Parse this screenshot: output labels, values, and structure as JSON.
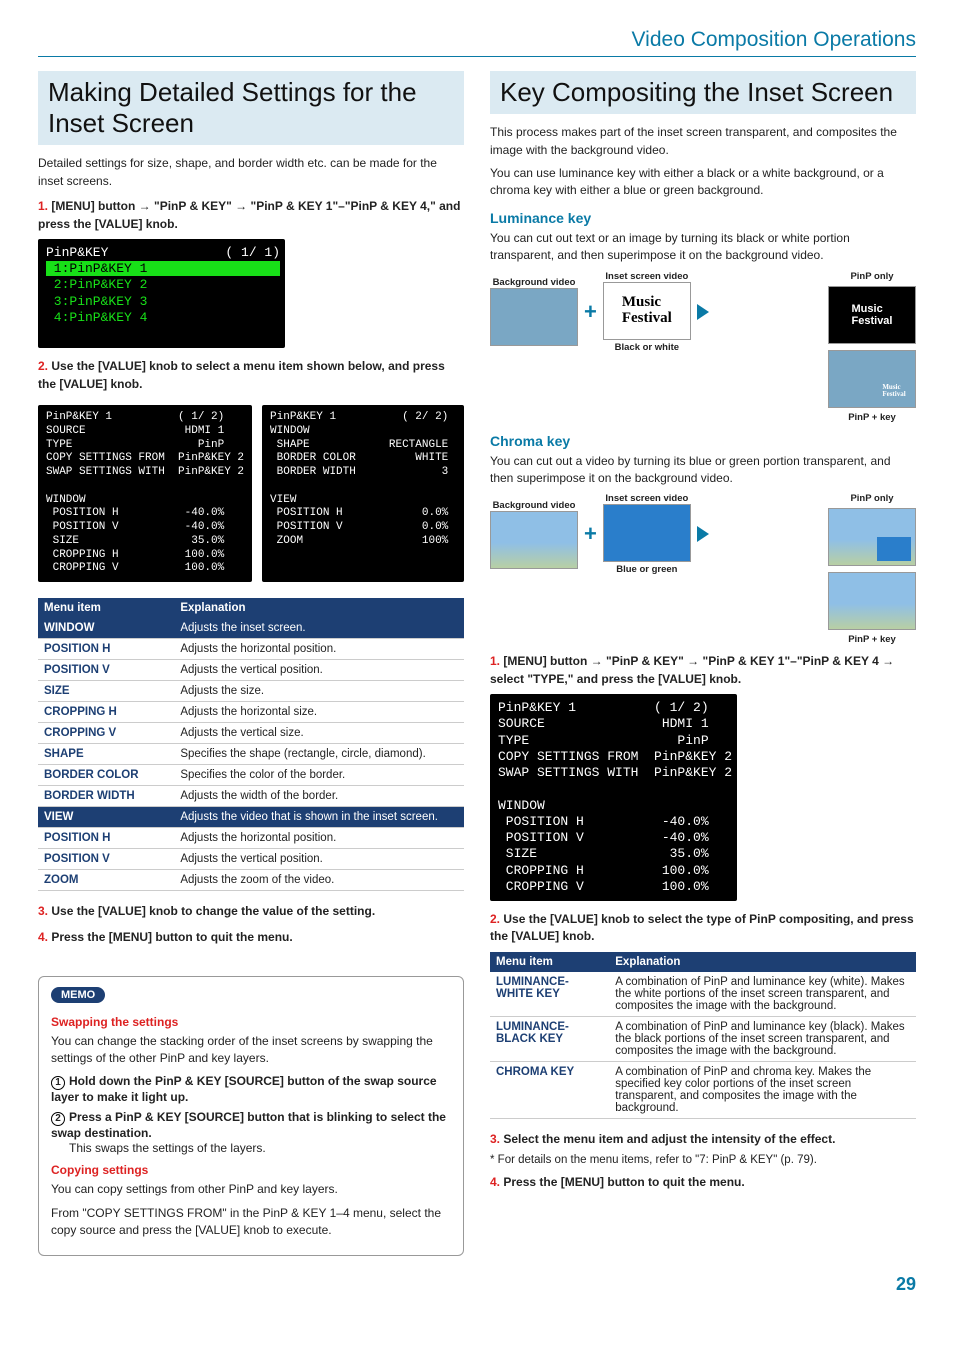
{
  "section_header": "Video Composition Operations",
  "left": {
    "title": "Making Detailed Settings for the Inset Screen",
    "intro": "Detailed settings for size, shape, and border width etc. can be made for the inset screens.",
    "step1_num": "1.",
    "step1_text": "[MENU] button → \"PinP & KEY\" → \"PinP & KEY 1\"–\"PinP & KEY 4,\" and press the [VALUE] knob.",
    "screen1": {
      "title_row": "PinP&KEY               ( 1/ 1)",
      "sel": " 1:PinP&KEY 1                 ",
      "lines": " 2:PinP&KEY 2\n 3:PinP&KEY 3\n 4:PinP&KEY 4\n\n"
    },
    "step2_num": "2.",
    "step2_text": "Use the [VALUE] knob to select a menu item shown below, and press the [VALUE] knob.",
    "screen2a": "PinP&KEY 1          ( 1/ 2)\nSOURCE               HDMI 1\nTYPE                   PinP\nCOPY SETTINGS FROM  PinP&KEY 2\nSWAP SETTINGS WITH  PinP&KEY 2\n\nWINDOW\n POSITION H          -40.0%\n POSITION V          -40.0%\n SIZE                 35.0%\n CROPPING H          100.0%\n CROPPING V          100.0%",
    "screen2b": "PinP&KEY 1          ( 2/ 2)\nWINDOW\n SHAPE            RECTANGLE\n BORDER COLOR         WHITE\n BORDER WIDTH             3\n\nVIEW\n POSITION H            0.0%\n POSITION V            0.0%\n ZOOM                  100%\n\n",
    "table_head": {
      "col1": "Menu item",
      "col2": "Explanation"
    },
    "rows": [
      {
        "k": "WINDOW",
        "v": "Adjusts the inset screen."
      },
      {
        "k": "POSITION H",
        "v": "Adjusts the horizontal position."
      },
      {
        "k": "POSITION V",
        "v": "Adjusts the vertical position."
      },
      {
        "k": "SIZE",
        "v": "Adjusts the size."
      },
      {
        "k": "CROPPING H",
        "v": "Adjusts the horizontal size."
      },
      {
        "k": "CROPPING V",
        "v": "Adjusts the vertical size."
      },
      {
        "k": "SHAPE",
        "v": "Specifies the shape (rectangle, circle, diamond)."
      },
      {
        "k": "BORDER COLOR",
        "v": "Specifies the color of the border."
      },
      {
        "k": "BORDER WIDTH",
        "v": "Adjusts the width of the border."
      },
      {
        "k": "VIEW",
        "v": "Adjusts the video that is shown in the inset screen."
      },
      {
        "k": "POSITION H",
        "v": "Adjusts the horizontal position."
      },
      {
        "k": "POSITION V",
        "v": "Adjusts the vertical position."
      },
      {
        "k": "ZOOM",
        "v": "Adjusts the zoom of the video."
      }
    ],
    "step3_num": "3.",
    "step3_text": "Use the [VALUE] knob to change the value of the setting.",
    "step4_num": "4.",
    "step4_text": "Press the [MENU] button to quit the menu.",
    "memo": {
      "badge": "MEMO",
      "h1": "Swapping the settings",
      "p1": "You can change the stacking order of the inset screens by swapping the settings of the other PinP and key layers.",
      "s1n": "1",
      "s1": "Hold down the PinP & KEY [SOURCE] button of the swap source layer to make it light up.",
      "s2n": "2",
      "s2": "Press a PinP & KEY [SOURCE] button that is blinking to select the swap destination.",
      "s2b": "This swaps the settings of the layers.",
      "h2": "Copying settings",
      "p2": "You can copy settings from other PinP and key layers.",
      "p3": "From \"COPY SETTINGS FROM\" in the PinP & KEY 1–4 menu, select the copy source and press the [VALUE] knob to execute."
    }
  },
  "right": {
    "title": "Key Compositing the Inset Screen",
    "intro1": "This process makes part of the inset screen transparent, and composites the image with the background video.",
    "intro2": "You can use luminance key with either a black or a white background, or a chroma key with either a blue or green background.",
    "lum_h": "Luminance key",
    "lum_p": "You can cut out text or an image by turning its black or white portion transparent, and then superimpose it on the background video.",
    "labels": {
      "bg": "Background video",
      "inset": "Inset screen video",
      "bw": "Black or white",
      "bg2": "Blue or green",
      "pinp_only": "PinP only",
      "pinp_key": "PinP + key",
      "music": "Music\nFestival"
    },
    "chroma_h": "Chroma key",
    "chroma_p": "You can cut out a video by turning its blue or green portion transparent, and then superimpose it on the background video.",
    "step1_num": "1.",
    "step1_text": "[MENU] button → \"PinP & KEY\" → \"PinP & KEY 1\"–\"PinP & KEY 4 → select \"TYPE,\" and press the [VALUE] knob.",
    "screen": "PinP&KEY 1          ( 1/ 2)\nSOURCE               HDMI 1\nTYPE                   PinP\nCOPY SETTINGS FROM  PinP&KEY 2\nSWAP SETTINGS WITH  PinP&KEY 2\n\nWINDOW\n POSITION H          -40.0%\n POSITION V          -40.0%\n SIZE                 35.0%\n CROPPING H          100.0%\n CROPPING V          100.0%",
    "step2_num": "2.",
    "step2_text": "Use the [VALUE] knob to select the type of PinP compositing, and press the [VALUE] knob.",
    "table_head": {
      "col1": "Menu item",
      "col2": "Explanation"
    },
    "t2": [
      {
        "k": "LUMINANCE-WHITE KEY",
        "v": "A combination of PinP and luminance key (white). Makes the white portions of the inset screen transparent, and composites the image with the background."
      },
      {
        "k": "LUMINANCE-BLACK KEY",
        "v": "A combination of PinP and luminance key (black). Makes the black portions of the inset screen transparent, and composites the image with the background."
      },
      {
        "k": "CHROMA KEY",
        "v": "A combination of PinP and chroma key. Makes the specified key color portions of the inset screen transparent, and composites the image with the background."
      }
    ],
    "step3_num": "3.",
    "step3_text": "Select the menu item and adjust the intensity of the effect.",
    "footnote": "* For details on the menu items, refer to \"7: PinP & KEY\" (p. 79).",
    "step4_num": "4.",
    "step4_text": "Press the [MENU] button to quit the menu."
  },
  "page": "29"
}
